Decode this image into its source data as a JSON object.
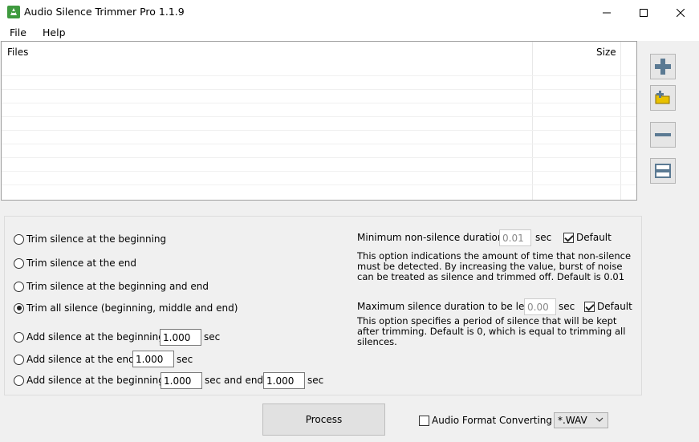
{
  "window": {
    "title": "Audio Silence Trimmer Pro 1.1.9"
  },
  "menu": {
    "items": [
      "File",
      "Help"
    ]
  },
  "file_list": {
    "columns": [
      "Files",
      "Size"
    ],
    "rows": []
  },
  "side_buttons": [
    {
      "name": "add-file-icon",
      "semantic": "plus"
    },
    {
      "name": "add-folder-icon",
      "semantic": "folder-plus"
    },
    {
      "name": "remove-file-icon",
      "semantic": "minus"
    },
    {
      "name": "clear-list-icon",
      "semantic": "clear"
    }
  ],
  "options": {
    "modes": [
      {
        "label": "Trim silence at the beginning",
        "selected": false
      },
      {
        "label": "Trim silence at the end",
        "selected": false
      },
      {
        "label": "Trim silence at the beginning and end",
        "selected": false
      },
      {
        "label": "Trim all silence (beginning, middle and end)",
        "selected": true
      },
      {
        "label": "Add silence at the beginning",
        "selected": false,
        "value": "1.000",
        "unit": "sec"
      },
      {
        "label": "Add silence at the end",
        "selected": false,
        "value": "1.000",
        "unit": "sec"
      },
      {
        "label": "Add silence at the beginning",
        "selected": false,
        "value": "1.000",
        "mid": "sec and end",
        "value2": "1.000",
        "unit": "sec"
      }
    ],
    "min_nonsilence": {
      "label": "Minimum non-silence duration",
      "value": "0.01",
      "unit": "sec",
      "default_label": "Default",
      "default_checked": true,
      "description": "This option indications the amount of time that non-silence must be detected. By increasing the value, burst of noise can be treated as silence and trimmed off. Default is 0.01",
      "description_lines": [
        "This option indications the amount of time that non-silence",
        "must be detected. By increasing the value, burst of noise",
        "can be treated as silence and trimmed off. Default is 0.01"
      ]
    },
    "max_silence": {
      "label": "Maximum silence duration to be left",
      "value": "0.00",
      "unit": "sec",
      "default_label": "Default",
      "default_checked": true,
      "description": "This option specifies a period of silence that will be kept after trimming. Default is 0, which is equal to trimming all silences.",
      "description_lines": [
        "This option specifies a period of silence that will be kept",
        "after trimming. Default is 0, which is equal to trimming all",
        "silences."
      ]
    }
  },
  "bottom": {
    "process_label": "Process",
    "format_converting_label": "Audio Format Converting",
    "format_converting_checked": false,
    "format_value": "*.WAV"
  },
  "colors": {
    "window_bg": "#f0f0f0",
    "list_bg": "#ffffff",
    "plus_icon": "#5b7a93",
    "folder_icon": "#e8c100"
  }
}
